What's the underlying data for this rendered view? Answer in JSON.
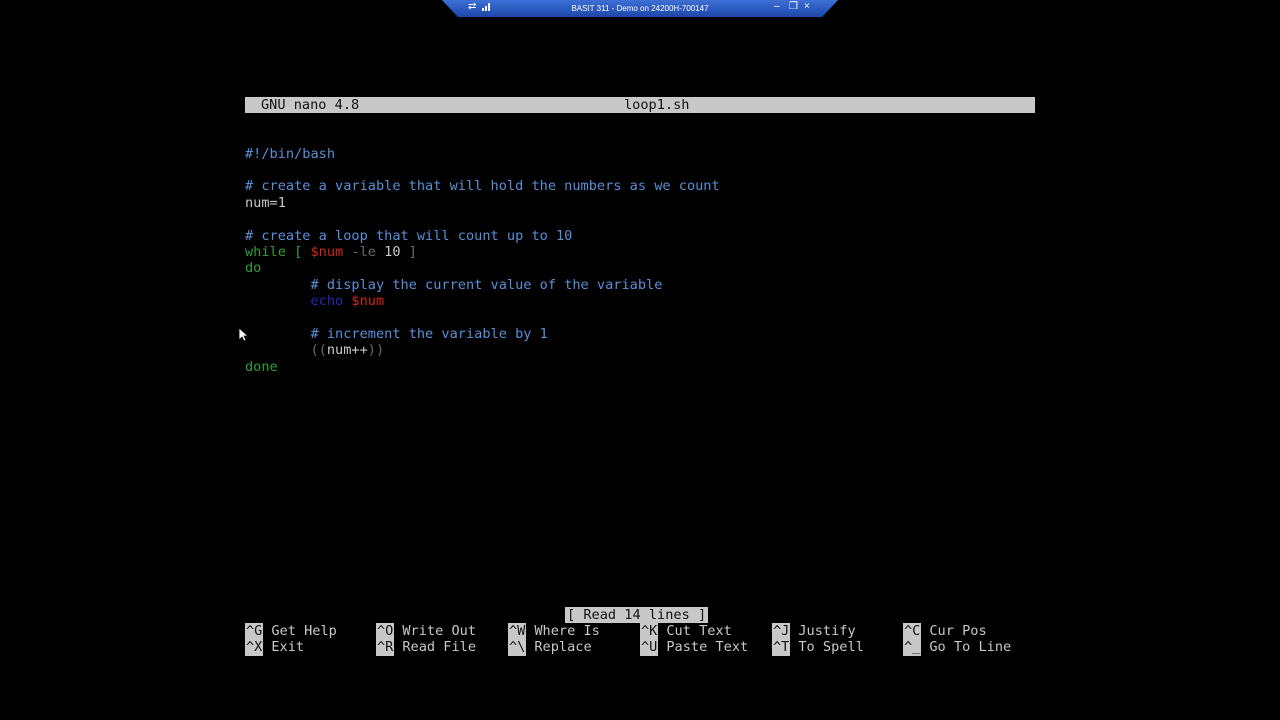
{
  "connection_bar": {
    "title": "BASIT 311 - Demo on 24200H-700147",
    "pin_icon": "pin-icon",
    "signal_icon": "signal-bars-icon",
    "minimize_glyph": "–",
    "restore_glyph": "❐",
    "close_glyph": "×"
  },
  "nano": {
    "version": "GNU nano 4.8",
    "filename": "loop1.sh",
    "lines": [
      [
        {
          "t": "#!/bin/bash",
          "c": "cmt"
        }
      ],
      [],
      [
        {
          "t": "# create a variable that will hold the numbers as we count",
          "c": "cmt"
        }
      ],
      [
        {
          "t": "num=1",
          "c": ""
        }
      ],
      [],
      [
        {
          "t": "# create a loop that will count up to 10",
          "c": "cmt"
        }
      ],
      [
        {
          "t": "while [ ",
          "c": "kw"
        },
        {
          "t": "$num",
          "c": "var"
        },
        {
          "t": " -le ",
          "c": "dim"
        },
        {
          "t": "10",
          "c": ""
        },
        {
          "t": " ]",
          "c": "dim"
        }
      ],
      [
        {
          "t": "do",
          "c": "kw"
        }
      ],
      [
        {
          "t": "        ",
          "c": ""
        },
        {
          "t": "# display the current value of the variable",
          "c": "cmt"
        }
      ],
      [
        {
          "t": "        ",
          "c": ""
        },
        {
          "t": "echo ",
          "c": "bi"
        },
        {
          "t": "$num",
          "c": "var"
        }
      ],
      [],
      [
        {
          "t": "        ",
          "c": ""
        },
        {
          "t": "# increment the variable by 1",
          "c": "cmt"
        }
      ],
      [
        {
          "t": "        ",
          "c": ""
        },
        {
          "t": "((",
          "c": "dim"
        },
        {
          "t": "num++",
          "c": ""
        },
        {
          "t": "))",
          "c": "dim"
        }
      ],
      [
        {
          "t": "done",
          "c": "kw"
        }
      ]
    ],
    "status_message": "[ Read 14 lines ]",
    "shortcuts": [
      {
        "key": "^G",
        "label": "Get Help"
      },
      {
        "key": "^O",
        "label": "Write Out"
      },
      {
        "key": "^W",
        "label": "Where Is"
      },
      {
        "key": "^K",
        "label": "Cut Text"
      },
      {
        "key": "^J",
        "label": "Justify"
      },
      {
        "key": "^C",
        "label": "Cur Pos"
      },
      {
        "key": "^X",
        "label": "Exit"
      },
      {
        "key": "^R",
        "label": "Read File"
      },
      {
        "key": "^\\",
        "label": "Replace"
      },
      {
        "key": "^U",
        "label": "Paste Text"
      },
      {
        "key": "^T",
        "label": "To Spell"
      },
      {
        "key": "^_",
        "label": "Go To Line"
      }
    ]
  }
}
